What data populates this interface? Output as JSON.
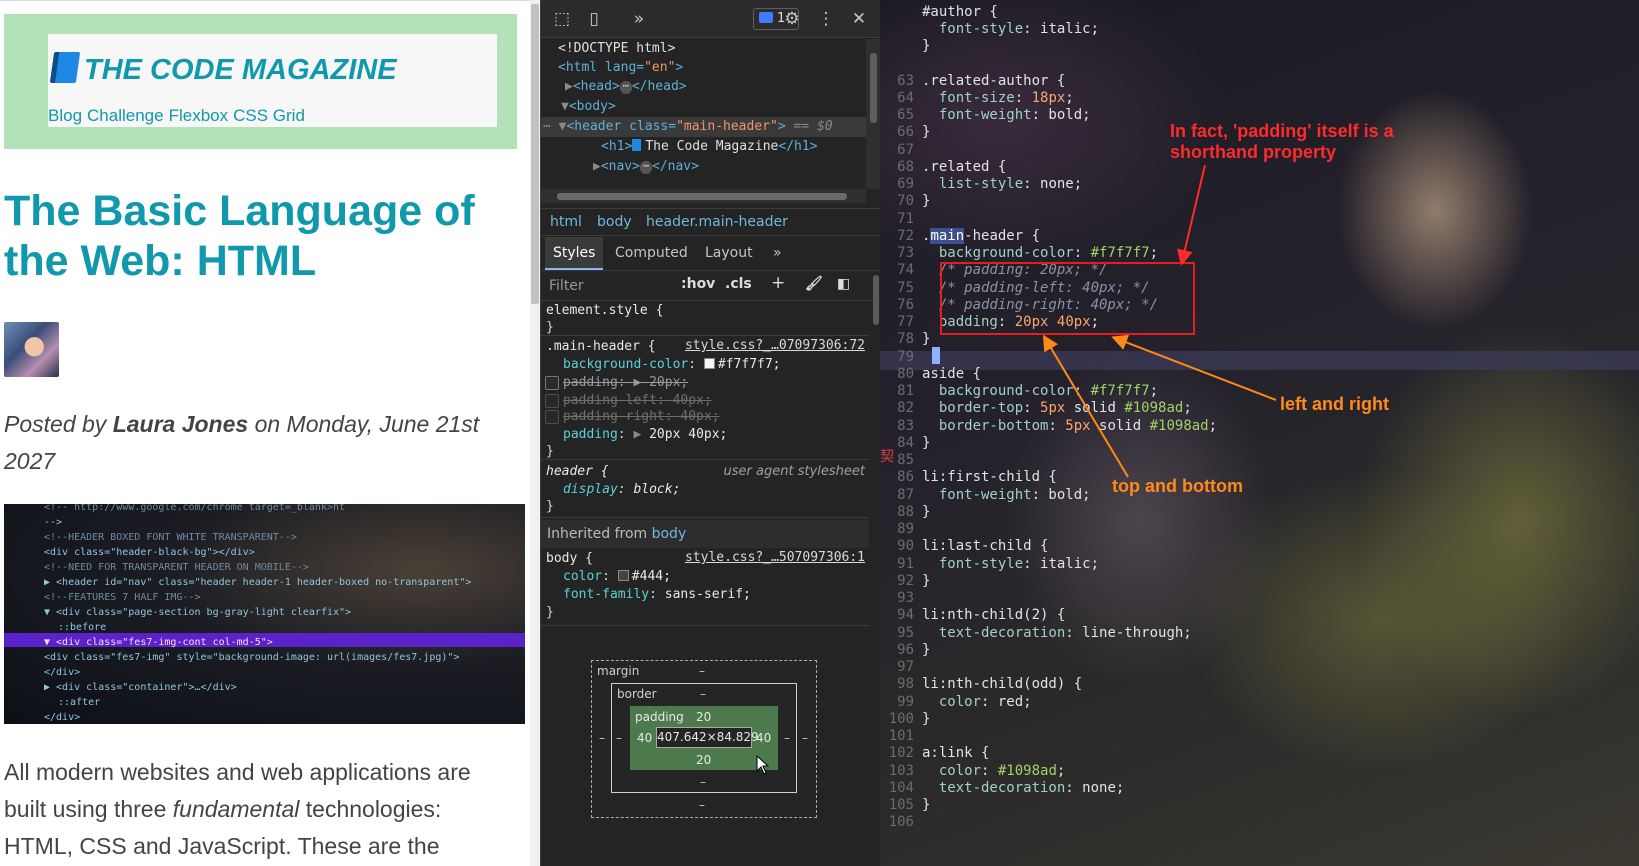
{
  "preview": {
    "site_title": "THE CODE MAGAZINE",
    "nav": [
      "Blog",
      "Challenge",
      "Flexbox",
      "CSS Grid"
    ],
    "heading": "The Basic Language of the Web: HTML",
    "meta_prefix": "Posted by ",
    "meta_author": "Laura Jones",
    "meta_suffix": " on Monday, June 21st 2027",
    "code_lines": [
      "  <!--  http://www.google.com/chrome  target=_blank>ht",
      "  -->",
      "  <!--HEADER BOXED FONT WHITE TRANSPARENT-->",
      "  <div class=\"header-black-bg\"></div>",
      "  <!--NEED FOR TRANSPARENT HEADER ON MOBILE-->",
      "▶ <header id=\"nav\" class=\"header header-1 header-boxed no-transparent\">",
      "  <!--FEATURES 7 HALF IMG-->",
      "▼ <div class=\"page-section bg-gray-light clearfix\">",
      "     ::before",
      "   ▼ <div class=\"fes7-img-cont col-md-5\">",
      "       <div class=\"fes7-img\" style=\"background-image: url(images/fes7.jpg)\">",
      "     </div>",
      "   ▶ <div class=\"container\">…</div>",
      "     ::after",
      "  </div>"
    ],
    "paragraph_pre": "All modern websites and web applications are built using three ",
    "paragraph_em": "fundamental",
    "paragraph_post": " technologies: HTML, CSS and JavaScript. These are the"
  },
  "devtools": {
    "toolbar": {
      "issues_count": "1"
    },
    "elements": {
      "doctype": "<!DOCTYPE html>",
      "html_open": "<html lang=",
      "html_lang": "\"en\"",
      "head": "<head>",
      "head_close": "</head>",
      "body": "<body>",
      "header_open": "<header class=",
      "header_class": "\"main-header\"",
      "selected_marker": "== $0",
      "h1_open": "<h1>",
      "h1_text": "The Code Magazine",
      "h1_close": "</h1>",
      "nav_open": "<nav>",
      "nav_close": "</nav>"
    },
    "breadcrumb": [
      "html",
      "body",
      "header.main-header"
    ],
    "tabs": [
      "Styles",
      "Computed",
      "Layout"
    ],
    "filter_placeholder": "Filter",
    "filter_buttons": [
      ":hov",
      ".cls",
      "+"
    ],
    "rules": {
      "element_style": "element.style {",
      "close": "}",
      "main_header": {
        "selector": ".main-header {",
        "source": "style.css?_…07097306:72",
        "bg_prop": "background-color",
        "bg_val": "#f7f7f7;",
        "padding_prop": "padding",
        "padding_val": "20px;",
        "padding_left_prop": "padding-left",
        "padding_left_val": "40px;",
        "padding_right_prop": "padding-right",
        "padding_right_val": "40px;",
        "padding2_prop": "padding",
        "padding2_val": "20px 40px;"
      },
      "header_ua": {
        "selector": "header {",
        "source": "user agent stylesheet",
        "prop": "display",
        "val": "block;"
      },
      "inherited_prefix": "Inherited from ",
      "inherited_from": "body",
      "body": {
        "selector": "body {",
        "source": "style.css?_…507097306:1",
        "color_prop": "color",
        "color_val": "#444;",
        "font_prop": "font-family",
        "font_val": "sans-serif;"
      }
    },
    "box_model": {
      "margin_label": "margin",
      "border_label": "border",
      "padding_label": "padding",
      "dash": "–",
      "padding_top": "20",
      "padding_bottom": "20",
      "padding_left": "40",
      "padding_right": "40",
      "content": "407.642×84.829"
    }
  },
  "editor": {
    "colors": {
      "accent": "#1098ad",
      "annotation_red": "#ff2a2a",
      "annotation_orange": "#ff8a1a"
    },
    "lines": [
      {
        "no": "",
        "code": "#author {"
      },
      {
        "no": "",
        "code": "  font-style: italic;"
      },
      {
        "no": "",
        "code": "}"
      },
      {
        "no": "",
        "code": ""
      },
      {
        "no": "63",
        "code": ".related-author {"
      },
      {
        "no": "64",
        "code": "  font-size: 18px;"
      },
      {
        "no": "65",
        "code": "  font-weight: bold;"
      },
      {
        "no": "66",
        "code": "}"
      },
      {
        "no": "67",
        "code": ""
      },
      {
        "no": "68",
        "code": ".related {"
      },
      {
        "no": "69",
        "code": "  list-style: none;"
      },
      {
        "no": "70",
        "code": "}"
      },
      {
        "no": "71",
        "code": ""
      },
      {
        "no": "72",
        "code": ".main-header {"
      },
      {
        "no": "73",
        "code": "  background-color: #f7f7f7;"
      },
      {
        "no": "74",
        "code": "  /* padding: 20px; */"
      },
      {
        "no": "75",
        "code": "  /* padding-left: 40px; */"
      },
      {
        "no": "76",
        "code": "  /* padding-right: 40px; */"
      },
      {
        "no": "77",
        "code": "  padding: 20px 40px;"
      },
      {
        "no": "78",
        "code": "}"
      },
      {
        "no": "79",
        "code": ""
      },
      {
        "no": "80",
        "code": "aside {"
      },
      {
        "no": "81",
        "code": "  background-color: #f7f7f7;"
      },
      {
        "no": "82",
        "code": "  border-top: 5px solid #1098ad;"
      },
      {
        "no": "83",
        "code": "  border-bottom: 5px solid #1098ad;"
      },
      {
        "no": "84",
        "code": "}"
      },
      {
        "no": "85",
        "code": ""
      },
      {
        "no": "86",
        "code": "li:first-child {"
      },
      {
        "no": "87",
        "code": "  font-weight: bold;"
      },
      {
        "no": "88",
        "code": "}"
      },
      {
        "no": "89",
        "code": ""
      },
      {
        "no": "90",
        "code": "li:last-child {"
      },
      {
        "no": "91",
        "code": "  font-style: italic;"
      },
      {
        "no": "92",
        "code": "}"
      },
      {
        "no": "93",
        "code": ""
      },
      {
        "no": "94",
        "code": "li:nth-child(2) {"
      },
      {
        "no": "95",
        "code": "  text-decoration: line-through;"
      },
      {
        "no": "96",
        "code": "}"
      },
      {
        "no": "97",
        "code": ""
      },
      {
        "no": "98",
        "code": "li:nth-child(odd) {"
      },
      {
        "no": "99",
        "code": "  color: red;"
      },
      {
        "no": "100",
        "code": "}"
      },
      {
        "no": "101",
        "code": ""
      },
      {
        "no": "102",
        "code": "a:link {"
      },
      {
        "no": "103",
        "code": "  color: #1098ad;"
      },
      {
        "no": "104",
        "code": "  text-decoration: none;"
      },
      {
        "no": "105",
        "code": "}"
      },
      {
        "no": "106",
        "code": ""
      }
    ],
    "annotations": {
      "shorthand_line1": "In fact, 'padding' itself is a",
      "shorthand_line2": "shorthand property",
      "left_right": "left and right",
      "top_bottom": "top and bottom"
    },
    "side_mark": "契"
  }
}
